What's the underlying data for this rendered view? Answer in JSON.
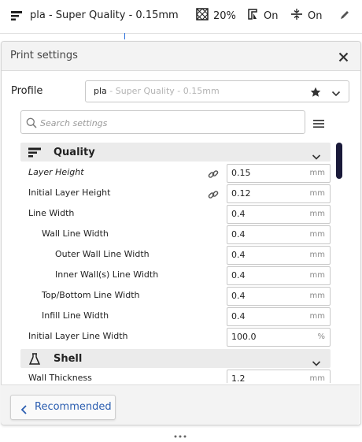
{
  "header": {
    "profile_summary": "pla - Super Quality - 0.15mm",
    "infill": "20%",
    "support": "On",
    "adhesion": "On"
  },
  "panel": {
    "title": "Print settings",
    "profile_label": "Profile",
    "profile_name": "pla",
    "profile_sub": " - Super Quality - 0.15mm",
    "search_placeholder": "Search settings"
  },
  "categories": [
    {
      "label": "Quality",
      "icon": "quality-icon"
    },
    {
      "label": "Shell",
      "icon": "shell-icon"
    }
  ],
  "settings": [
    {
      "label": "Layer Height",
      "value": "0.15",
      "unit": "mm",
      "italic": true,
      "linked": true
    },
    {
      "label": "Initial Layer Height",
      "value": "0.12",
      "unit": "mm",
      "linked": true
    },
    {
      "label": "Line Width",
      "value": "0.4",
      "unit": "mm"
    },
    {
      "label": "Wall Line Width",
      "value": "0.4",
      "unit": "mm"
    },
    {
      "label": "Outer Wall Line Width",
      "value": "0.4",
      "unit": "mm"
    },
    {
      "label": "Inner Wall(s) Line Width",
      "value": "0.4",
      "unit": "mm"
    },
    {
      "label": "Top/Bottom Line Width",
      "value": "0.4",
      "unit": "mm"
    },
    {
      "label": "Infill Line Width",
      "value": "0.4",
      "unit": "mm"
    },
    {
      "label": "Initial Layer Line Width",
      "value": "100.0",
      "unit": "%"
    },
    {
      "label": "Wall Thickness",
      "value": "1.2",
      "unit": "mm"
    }
  ],
  "footer": {
    "recommended_label": "Recommended"
  },
  "colors": {
    "accent": "#2a5db0",
    "scrollbar": "#1a1a3a"
  }
}
